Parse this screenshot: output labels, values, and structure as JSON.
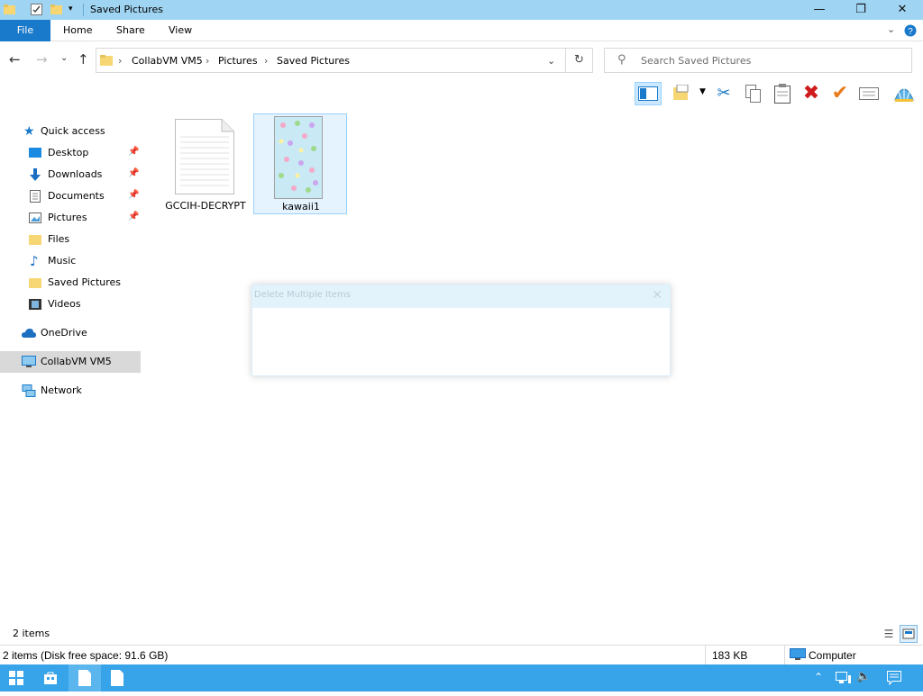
{
  "window": {
    "title": "Saved Pictures"
  },
  "ribbon": {
    "tabs": [
      "File",
      "Home",
      "Share",
      "View"
    ]
  },
  "address": {
    "crumbs": [
      "CollabVM VM5",
      "Pictures",
      "Saved Pictures"
    ],
    "search_placeholder": "Search Saved Pictures"
  },
  "nav": {
    "quick_access": "Quick access",
    "items": [
      "Desktop",
      "Downloads",
      "Documents",
      "Pictures",
      "Files",
      "Music",
      "Saved Pictures",
      "Videos"
    ],
    "onedrive": "OneDrive",
    "thispc": "CollabVM VM5",
    "network": "Network"
  },
  "files": [
    {
      "name": "GCCIH-DECRYPT",
      "icon": "text-document-icon"
    },
    {
      "name": "kawaii1",
      "icon": "image-thumbnail-icon"
    }
  ],
  "dialog": {
    "title": "Delete Multiple Items"
  },
  "status": {
    "count": "2 items",
    "detail": "2 items (Disk free space: 91.6 GB)",
    "size": "183 KB",
    "location": "Computer"
  },
  "colors": {
    "accent": "#1979ca",
    "titlebar": "#9fd4f2",
    "taskbar": "#37a3e8",
    "selected": "#cce8ff"
  }
}
